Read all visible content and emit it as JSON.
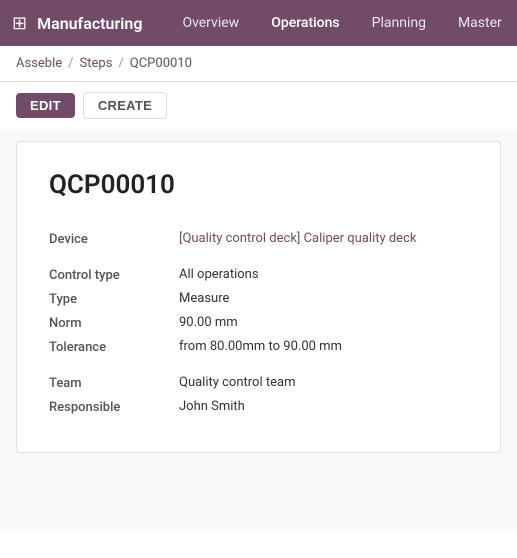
{
  "nav": {
    "brand": "Manufacturing",
    "links": [
      {
        "label": "Overview",
        "active": false
      },
      {
        "label": "Operations",
        "active": true
      },
      {
        "label": "Planning",
        "active": false
      },
      {
        "label": "Master",
        "active": false
      }
    ]
  },
  "breadcrumb": {
    "parent1": "Asseble",
    "sep1": "/",
    "parent2": "Steps",
    "sep2": "/",
    "current": "QCP00010"
  },
  "actions": {
    "edit_label": "EDIT",
    "create_label": "CREATE"
  },
  "record": {
    "title": "QCP00010",
    "fields": {
      "device_label": "Device",
      "device_value": "[Quality control deck] Caliper quality deck",
      "control_type_label": "Control type",
      "control_type_value": "All operations",
      "type_label": "Type",
      "type_value": "Measure",
      "norm_label": "Norm",
      "norm_value": "90.00 mm",
      "tolerance_label": "Tolerance",
      "tolerance_value": "from 80.00mm to 90.00 mm",
      "team_label": "Team",
      "team_value": "Quality control team",
      "responsible_label": "Responsible",
      "responsible_value": "John Smith"
    }
  }
}
